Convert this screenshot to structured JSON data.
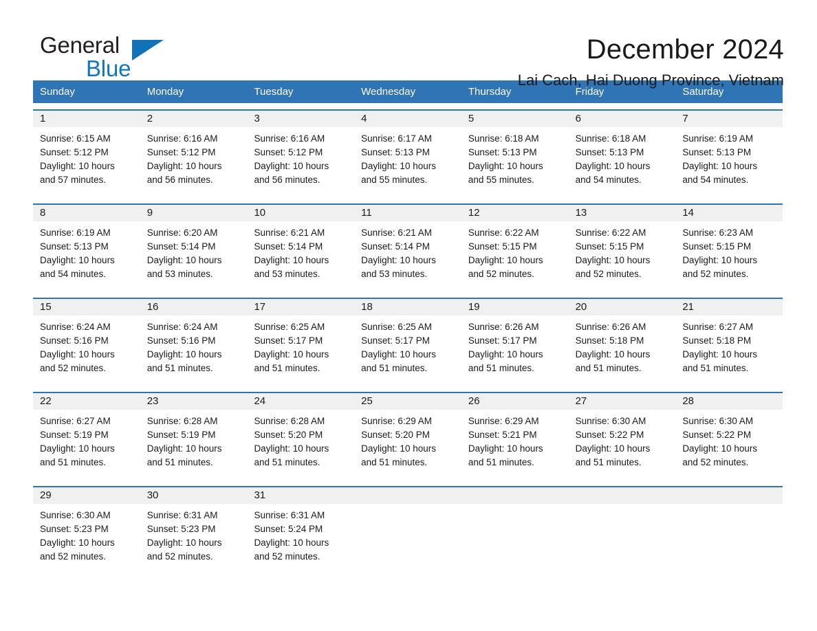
{
  "brand": {
    "name_part1": "General",
    "name_part2": "Blue",
    "triangle_icon": "triangle-icon",
    "color_black": "#231f20",
    "color_blue": "#0f76c3"
  },
  "header": {
    "month_title": "December 2024",
    "location": "Lai Cach, Hai Duong Province, Vietnam"
  },
  "theme": {
    "header_blue": "#2f74b5",
    "daynum_gray": "#f0f0f0",
    "text": "#1a1a1a",
    "white": "#ffffff"
  },
  "weekdays": [
    "Sunday",
    "Monday",
    "Tuesday",
    "Wednesday",
    "Thursday",
    "Friday",
    "Saturday"
  ],
  "weeks": [
    {
      "days": [
        {
          "date": "1",
          "sunrise": "Sunrise: 6:15 AM",
          "sunset": "Sunset: 5:12 PM",
          "daylight_line1": "Daylight: 10 hours",
          "daylight_line2": "and 57 minutes."
        },
        {
          "date": "2",
          "sunrise": "Sunrise: 6:16 AM",
          "sunset": "Sunset: 5:12 PM",
          "daylight_line1": "Daylight: 10 hours",
          "daylight_line2": "and 56 minutes."
        },
        {
          "date": "3",
          "sunrise": "Sunrise: 6:16 AM",
          "sunset": "Sunset: 5:12 PM",
          "daylight_line1": "Daylight: 10 hours",
          "daylight_line2": "and 56 minutes."
        },
        {
          "date": "4",
          "sunrise": "Sunrise: 6:17 AM",
          "sunset": "Sunset: 5:13 PM",
          "daylight_line1": "Daylight: 10 hours",
          "daylight_line2": "and 55 minutes."
        },
        {
          "date": "5",
          "sunrise": "Sunrise: 6:18 AM",
          "sunset": "Sunset: 5:13 PM",
          "daylight_line1": "Daylight: 10 hours",
          "daylight_line2": "and 55 minutes."
        },
        {
          "date": "6",
          "sunrise": "Sunrise: 6:18 AM",
          "sunset": "Sunset: 5:13 PM",
          "daylight_line1": "Daylight: 10 hours",
          "daylight_line2": "and 54 minutes."
        },
        {
          "date": "7",
          "sunrise": "Sunrise: 6:19 AM",
          "sunset": "Sunset: 5:13 PM",
          "daylight_line1": "Daylight: 10 hours",
          "daylight_line2": "and 54 minutes."
        }
      ]
    },
    {
      "days": [
        {
          "date": "8",
          "sunrise": "Sunrise: 6:19 AM",
          "sunset": "Sunset: 5:13 PM",
          "daylight_line1": "Daylight: 10 hours",
          "daylight_line2": "and 54 minutes."
        },
        {
          "date": "9",
          "sunrise": "Sunrise: 6:20 AM",
          "sunset": "Sunset: 5:14 PM",
          "daylight_line1": "Daylight: 10 hours",
          "daylight_line2": "and 53 minutes."
        },
        {
          "date": "10",
          "sunrise": "Sunrise: 6:21 AM",
          "sunset": "Sunset: 5:14 PM",
          "daylight_line1": "Daylight: 10 hours",
          "daylight_line2": "and 53 minutes."
        },
        {
          "date": "11",
          "sunrise": "Sunrise: 6:21 AM",
          "sunset": "Sunset: 5:14 PM",
          "daylight_line1": "Daylight: 10 hours",
          "daylight_line2": "and 53 minutes."
        },
        {
          "date": "12",
          "sunrise": "Sunrise: 6:22 AM",
          "sunset": "Sunset: 5:15 PM",
          "daylight_line1": "Daylight: 10 hours",
          "daylight_line2": "and 52 minutes."
        },
        {
          "date": "13",
          "sunrise": "Sunrise: 6:22 AM",
          "sunset": "Sunset: 5:15 PM",
          "daylight_line1": "Daylight: 10 hours",
          "daylight_line2": "and 52 minutes."
        },
        {
          "date": "14",
          "sunrise": "Sunrise: 6:23 AM",
          "sunset": "Sunset: 5:15 PM",
          "daylight_line1": "Daylight: 10 hours",
          "daylight_line2": "and 52 minutes."
        }
      ]
    },
    {
      "days": [
        {
          "date": "15",
          "sunrise": "Sunrise: 6:24 AM",
          "sunset": "Sunset: 5:16 PM",
          "daylight_line1": "Daylight: 10 hours",
          "daylight_line2": "and 52 minutes."
        },
        {
          "date": "16",
          "sunrise": "Sunrise: 6:24 AM",
          "sunset": "Sunset: 5:16 PM",
          "daylight_line1": "Daylight: 10 hours",
          "daylight_line2": "and 51 minutes."
        },
        {
          "date": "17",
          "sunrise": "Sunrise: 6:25 AM",
          "sunset": "Sunset: 5:17 PM",
          "daylight_line1": "Daylight: 10 hours",
          "daylight_line2": "and 51 minutes."
        },
        {
          "date": "18",
          "sunrise": "Sunrise: 6:25 AM",
          "sunset": "Sunset: 5:17 PM",
          "daylight_line1": "Daylight: 10 hours",
          "daylight_line2": "and 51 minutes."
        },
        {
          "date": "19",
          "sunrise": "Sunrise: 6:26 AM",
          "sunset": "Sunset: 5:17 PM",
          "daylight_line1": "Daylight: 10 hours",
          "daylight_line2": "and 51 minutes."
        },
        {
          "date": "20",
          "sunrise": "Sunrise: 6:26 AM",
          "sunset": "Sunset: 5:18 PM",
          "daylight_line1": "Daylight: 10 hours",
          "daylight_line2": "and 51 minutes."
        },
        {
          "date": "21",
          "sunrise": "Sunrise: 6:27 AM",
          "sunset": "Sunset: 5:18 PM",
          "daylight_line1": "Daylight: 10 hours",
          "daylight_line2": "and 51 minutes."
        }
      ]
    },
    {
      "days": [
        {
          "date": "22",
          "sunrise": "Sunrise: 6:27 AM",
          "sunset": "Sunset: 5:19 PM",
          "daylight_line1": "Daylight: 10 hours",
          "daylight_line2": "and 51 minutes."
        },
        {
          "date": "23",
          "sunrise": "Sunrise: 6:28 AM",
          "sunset": "Sunset: 5:19 PM",
          "daylight_line1": "Daylight: 10 hours",
          "daylight_line2": "and 51 minutes."
        },
        {
          "date": "24",
          "sunrise": "Sunrise: 6:28 AM",
          "sunset": "Sunset: 5:20 PM",
          "daylight_line1": "Daylight: 10 hours",
          "daylight_line2": "and 51 minutes."
        },
        {
          "date": "25",
          "sunrise": "Sunrise: 6:29 AM",
          "sunset": "Sunset: 5:20 PM",
          "daylight_line1": "Daylight: 10 hours",
          "daylight_line2": "and 51 minutes."
        },
        {
          "date": "26",
          "sunrise": "Sunrise: 6:29 AM",
          "sunset": "Sunset: 5:21 PM",
          "daylight_line1": "Daylight: 10 hours",
          "daylight_line2": "and 51 minutes."
        },
        {
          "date": "27",
          "sunrise": "Sunrise: 6:30 AM",
          "sunset": "Sunset: 5:22 PM",
          "daylight_line1": "Daylight: 10 hours",
          "daylight_line2": "and 51 minutes."
        },
        {
          "date": "28",
          "sunrise": "Sunrise: 6:30 AM",
          "sunset": "Sunset: 5:22 PM",
          "daylight_line1": "Daylight: 10 hours",
          "daylight_line2": "and 52 minutes."
        }
      ]
    },
    {
      "days": [
        {
          "date": "29",
          "sunrise": "Sunrise: 6:30 AM",
          "sunset": "Sunset: 5:23 PM",
          "daylight_line1": "Daylight: 10 hours",
          "daylight_line2": "and 52 minutes."
        },
        {
          "date": "30",
          "sunrise": "Sunrise: 6:31 AM",
          "sunset": "Sunset: 5:23 PM",
          "daylight_line1": "Daylight: 10 hours",
          "daylight_line2": "and 52 minutes."
        },
        {
          "date": "31",
          "sunrise": "Sunrise: 6:31 AM",
          "sunset": "Sunset: 5:24 PM",
          "daylight_line1": "Daylight: 10 hours",
          "daylight_line2": "and 52 minutes."
        },
        {
          "date": "",
          "sunrise": "",
          "sunset": "",
          "daylight_line1": "",
          "daylight_line2": ""
        },
        {
          "date": "",
          "sunrise": "",
          "sunset": "",
          "daylight_line1": "",
          "daylight_line2": ""
        },
        {
          "date": "",
          "sunrise": "",
          "sunset": "",
          "daylight_line1": "",
          "daylight_line2": ""
        },
        {
          "date": "",
          "sunrise": "",
          "sunset": "",
          "daylight_line1": "",
          "daylight_line2": ""
        }
      ]
    }
  ]
}
